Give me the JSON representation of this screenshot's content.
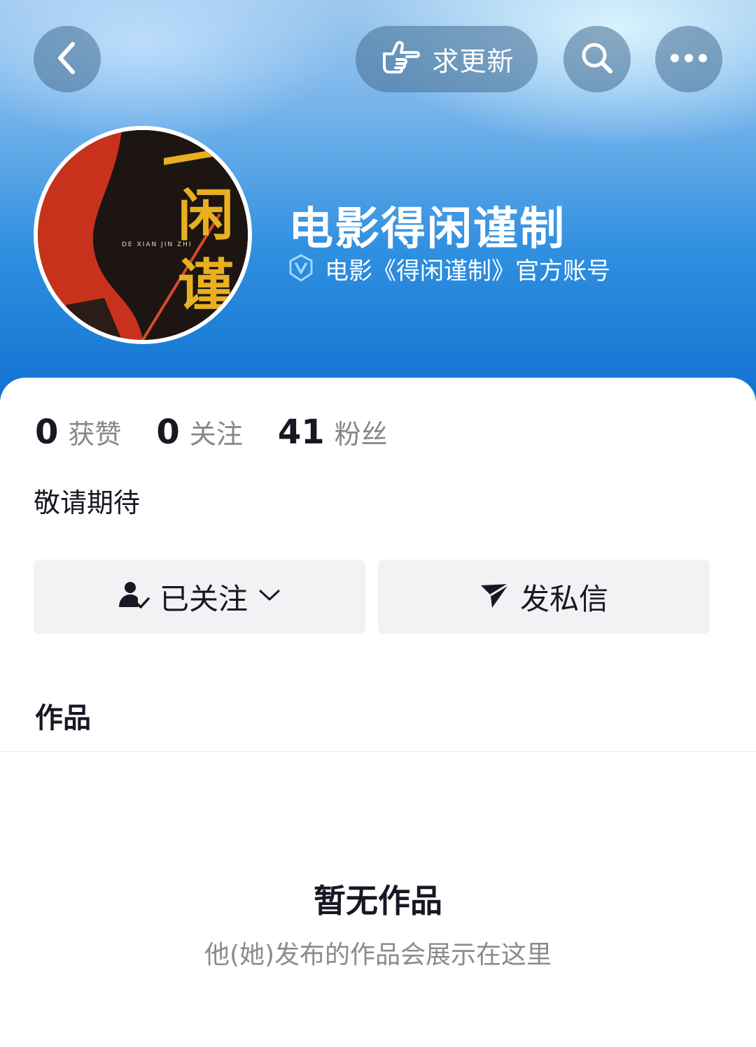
{
  "header": {
    "request_update_label": "求更新",
    "account_name": "电影得闲谨制",
    "verified_text": "电影《得闲谨制》官方账号"
  },
  "avatar": {
    "poster_title": "闲谨",
    "poster_subtitle": "DE XIAN JIN ZHI"
  },
  "stats": [
    {
      "num": "0",
      "label": "获赞"
    },
    {
      "num": "0",
      "label": "关注"
    },
    {
      "num": "41",
      "label": "粉丝"
    }
  ],
  "bio": "敬请期待",
  "actions": {
    "follow_label": "已关注",
    "message_label": "发私信"
  },
  "works": {
    "title": "作品",
    "empty_title": "暂无作品",
    "empty_subtitle": "他(她)发布的作品会展示在这里"
  },
  "colors": {
    "header_blue": "#0d6fd0",
    "text_primary": "#161823",
    "text_secondary": "#86868b",
    "button_bg": "#f2f2f4"
  },
  "icons": [
    "back-arrow-icon",
    "pointing-hand-icon",
    "search-icon",
    "more-icon",
    "verified-icon",
    "followed-user-icon",
    "chevron-down-icon",
    "send-icon"
  ]
}
